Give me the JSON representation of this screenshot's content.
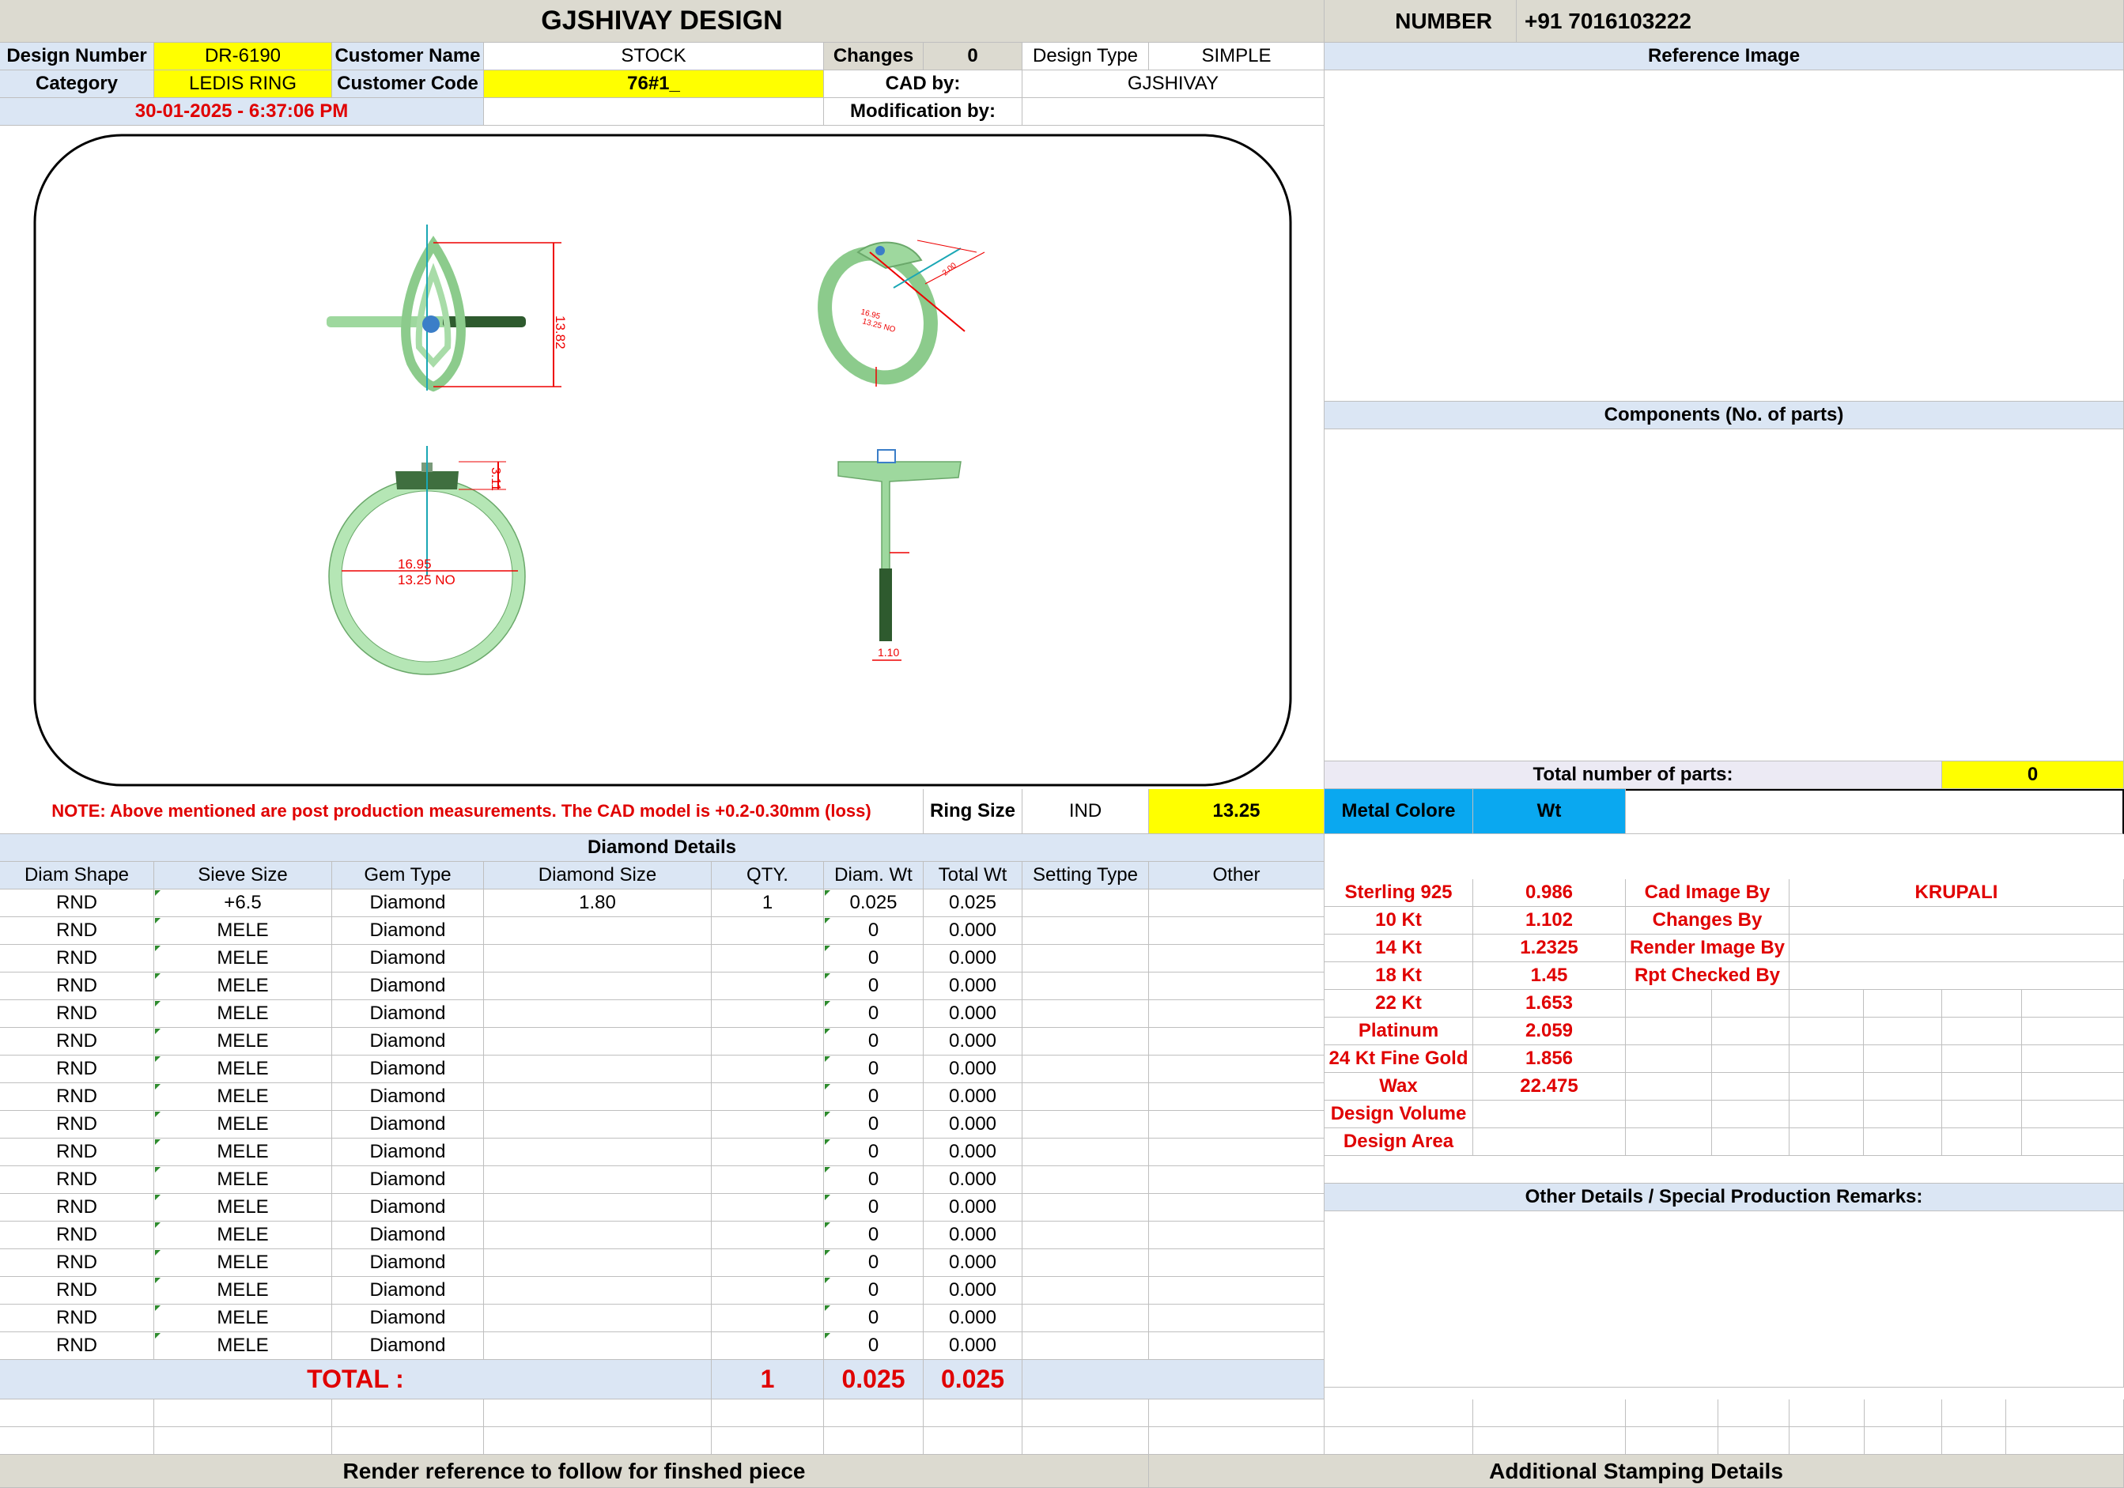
{
  "header": {
    "title": "GJSHIVAY DESIGN",
    "number_label": "NUMBER",
    "number_value": "+91 7016103222"
  },
  "info": {
    "design_number_label": "Design Number",
    "design_number": "DR-6190",
    "customer_name_label": "Customer Name",
    "customer_name": "STOCK",
    "changes_label": "Changes",
    "changes": "0",
    "design_type_label": "Design Type",
    "design_type": "SIMPLE",
    "category_label": "Category",
    "category": "LEDIS RING",
    "customer_code_label": "Customer Code",
    "customer_code": "76#1_",
    "cad_by_label": "CAD by:",
    "cad_by": "GJSHIVAY",
    "datetime": "30-01-2025 - 6:37:06 PM",
    "modification_label": "Modification by:",
    "modification": ""
  },
  "right_panel": {
    "reference_image": "Reference Image",
    "components": "Components (No. of parts)",
    "total_parts_label": "Total number of parts:",
    "total_parts": "0"
  },
  "drawing": {
    "top_height": "13.82",
    "side_dims": [
      "16.95",
      "13.25 NO"
    ],
    "front_inner_1": "16.95",
    "front_inner_2": "13.25 NO",
    "front_head": "3.11",
    "profile_width": "1.10",
    "iso_dim": "2.00"
  },
  "note": {
    "text": "NOTE: Above mentioned are post production measurements. The CAD model is +0.2-0.30mm (loss)",
    "ring_size_label": "Ring Size",
    "ring_size_std": "IND",
    "ring_size": "13.25"
  },
  "diamond": {
    "section_title": "Diamond Details",
    "columns": [
      "Diam Shape",
      "Sieve Size",
      "Gem Type",
      "Diamond Size",
      "QTY.",
      "Diam. Wt",
      "Total Wt",
      "Setting Type",
      "Other"
    ],
    "rows": [
      [
        "RND",
        "+6.5",
        "Diamond",
        "1.80",
        "1",
        "0.025",
        "0.025",
        "",
        ""
      ],
      [
        "RND",
        "MELE",
        "Diamond",
        "",
        "",
        "0",
        "0.000",
        "",
        ""
      ],
      [
        "RND",
        "MELE",
        "Diamond",
        "",
        "",
        "0",
        "0.000",
        "",
        ""
      ],
      [
        "RND",
        "MELE",
        "Diamond",
        "",
        "",
        "0",
        "0.000",
        "",
        ""
      ],
      [
        "RND",
        "MELE",
        "Diamond",
        "",
        "",
        "0",
        "0.000",
        "",
        ""
      ],
      [
        "RND",
        "MELE",
        "Diamond",
        "",
        "",
        "0",
        "0.000",
        "",
        ""
      ],
      [
        "RND",
        "MELE",
        "Diamond",
        "",
        "",
        "0",
        "0.000",
        "",
        ""
      ],
      [
        "RND",
        "MELE",
        "Diamond",
        "",
        "",
        "0",
        "0.000",
        "",
        ""
      ],
      [
        "RND",
        "MELE",
        "Diamond",
        "",
        "",
        "0",
        "0.000",
        "",
        ""
      ],
      [
        "RND",
        "MELE",
        "Diamond",
        "",
        "",
        "0",
        "0.000",
        "",
        ""
      ],
      [
        "RND",
        "MELE",
        "Diamond",
        "",
        "",
        "0",
        "0.000",
        "",
        ""
      ],
      [
        "RND",
        "MELE",
        "Diamond",
        "",
        "",
        "0",
        "0.000",
        "",
        ""
      ],
      [
        "RND",
        "MELE",
        "Diamond",
        "",
        "",
        "0",
        "0.000",
        "",
        ""
      ],
      [
        "RND",
        "MELE",
        "Diamond",
        "",
        "",
        "0",
        "0.000",
        "",
        ""
      ],
      [
        "RND",
        "MELE",
        "Diamond",
        "",
        "",
        "0",
        "0.000",
        "",
        ""
      ],
      [
        "RND",
        "MELE",
        "Diamond",
        "",
        "",
        "0",
        "0.000",
        "",
        ""
      ],
      [
        "RND",
        "MELE",
        "Diamond",
        "",
        "",
        "0",
        "0.000",
        "",
        ""
      ]
    ],
    "total_label": "TOTAL :",
    "total_qty": "1",
    "total_diam_wt": "0.025",
    "total_wt": "0.025"
  },
  "metal": {
    "header_label": "Metal Colore",
    "header_wt": "Wt",
    "rows": [
      {
        "name": "Sterling 925",
        "wt": "0.986"
      },
      {
        "name": "10 Kt",
        "wt": "1.102"
      },
      {
        "name": "14 Kt",
        "wt": "1.2325"
      },
      {
        "name": "18 Kt",
        "wt": "1.45"
      },
      {
        "name": "22 Kt",
        "wt": "1.653"
      },
      {
        "name": "Platinum",
        "wt": "2.059"
      },
      {
        "name": "24 Kt Fine Gold",
        "wt": "1.856"
      },
      {
        "name": "Wax",
        "wt": "22.475"
      },
      {
        "name": "Design Volume",
        "wt": ""
      },
      {
        "name": "Design Area",
        "wt": ""
      }
    ]
  },
  "credits": [
    {
      "label": "Cad Image By",
      "value": "KRUPALI"
    },
    {
      "label": "Changes By",
      "value": ""
    },
    {
      "label": "Render Image By",
      "value": ""
    },
    {
      "label": "Rpt Checked By",
      "value": ""
    }
  ],
  "remarks_title": "Other Details / Special Production Remarks:",
  "footer": {
    "left": "Render reference to follow for finshed piece",
    "right": "Additional Stamping Details"
  },
  "colors": {
    "highlight": "#ffff00",
    "header_bg": "#dcdad0",
    "table_blue": "#dbe6f4",
    "metal_cyan": "#0aa8f0",
    "alert_red": "#e00000",
    "ring_green": "#b5e6b5"
  }
}
